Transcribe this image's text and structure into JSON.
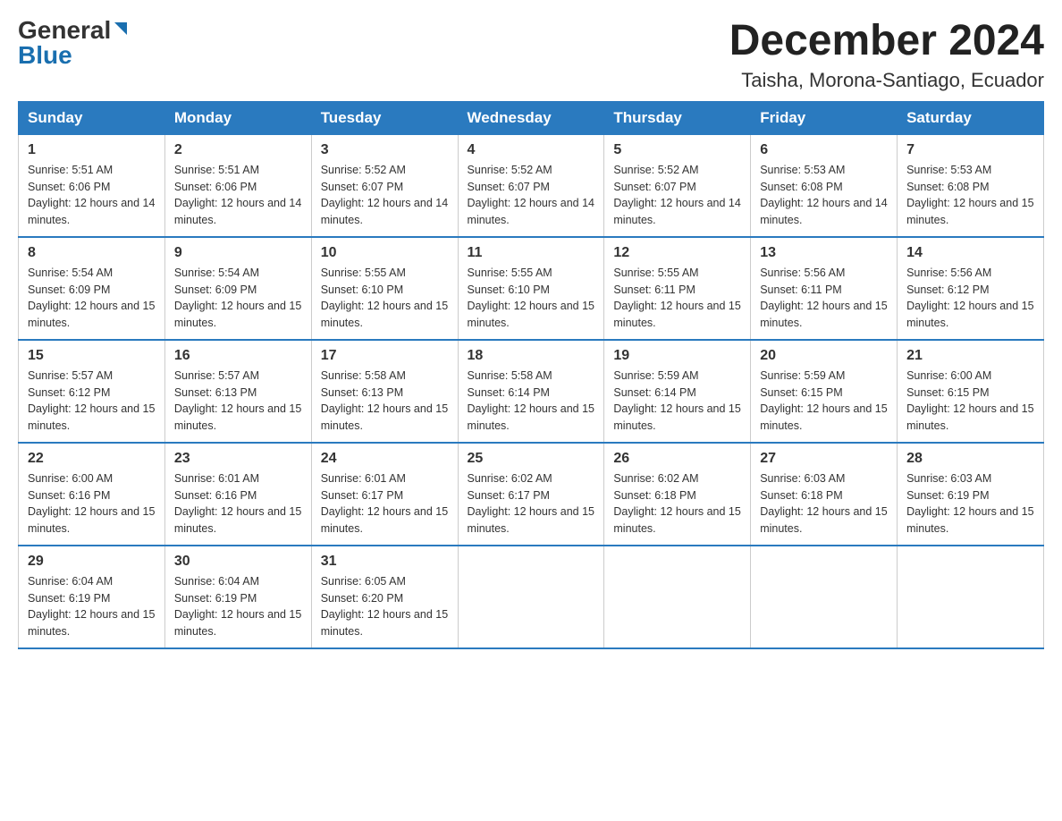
{
  "header": {
    "logo_general": "General",
    "logo_blue": "Blue",
    "month_title": "December 2024",
    "location": "Taisha, Morona-Santiago, Ecuador"
  },
  "days_of_week": [
    "Sunday",
    "Monday",
    "Tuesday",
    "Wednesday",
    "Thursday",
    "Friday",
    "Saturday"
  ],
  "weeks": [
    [
      {
        "day": "1",
        "sunrise": "5:51 AM",
        "sunset": "6:06 PM",
        "daylight": "12 hours and 14 minutes."
      },
      {
        "day": "2",
        "sunrise": "5:51 AM",
        "sunset": "6:06 PM",
        "daylight": "12 hours and 14 minutes."
      },
      {
        "day": "3",
        "sunrise": "5:52 AM",
        "sunset": "6:07 PM",
        "daylight": "12 hours and 14 minutes."
      },
      {
        "day": "4",
        "sunrise": "5:52 AM",
        "sunset": "6:07 PM",
        "daylight": "12 hours and 14 minutes."
      },
      {
        "day": "5",
        "sunrise": "5:52 AM",
        "sunset": "6:07 PM",
        "daylight": "12 hours and 14 minutes."
      },
      {
        "day": "6",
        "sunrise": "5:53 AM",
        "sunset": "6:08 PM",
        "daylight": "12 hours and 14 minutes."
      },
      {
        "day": "7",
        "sunrise": "5:53 AM",
        "sunset": "6:08 PM",
        "daylight": "12 hours and 15 minutes."
      }
    ],
    [
      {
        "day": "8",
        "sunrise": "5:54 AM",
        "sunset": "6:09 PM",
        "daylight": "12 hours and 15 minutes."
      },
      {
        "day": "9",
        "sunrise": "5:54 AM",
        "sunset": "6:09 PM",
        "daylight": "12 hours and 15 minutes."
      },
      {
        "day": "10",
        "sunrise": "5:55 AM",
        "sunset": "6:10 PM",
        "daylight": "12 hours and 15 minutes."
      },
      {
        "day": "11",
        "sunrise": "5:55 AM",
        "sunset": "6:10 PM",
        "daylight": "12 hours and 15 minutes."
      },
      {
        "day": "12",
        "sunrise": "5:55 AM",
        "sunset": "6:11 PM",
        "daylight": "12 hours and 15 minutes."
      },
      {
        "day": "13",
        "sunrise": "5:56 AM",
        "sunset": "6:11 PM",
        "daylight": "12 hours and 15 minutes."
      },
      {
        "day": "14",
        "sunrise": "5:56 AM",
        "sunset": "6:12 PM",
        "daylight": "12 hours and 15 minutes."
      }
    ],
    [
      {
        "day": "15",
        "sunrise": "5:57 AM",
        "sunset": "6:12 PM",
        "daylight": "12 hours and 15 minutes."
      },
      {
        "day": "16",
        "sunrise": "5:57 AM",
        "sunset": "6:13 PM",
        "daylight": "12 hours and 15 minutes."
      },
      {
        "day": "17",
        "sunrise": "5:58 AM",
        "sunset": "6:13 PM",
        "daylight": "12 hours and 15 minutes."
      },
      {
        "day": "18",
        "sunrise": "5:58 AM",
        "sunset": "6:14 PM",
        "daylight": "12 hours and 15 minutes."
      },
      {
        "day": "19",
        "sunrise": "5:59 AM",
        "sunset": "6:14 PM",
        "daylight": "12 hours and 15 minutes."
      },
      {
        "day": "20",
        "sunrise": "5:59 AM",
        "sunset": "6:15 PM",
        "daylight": "12 hours and 15 minutes."
      },
      {
        "day": "21",
        "sunrise": "6:00 AM",
        "sunset": "6:15 PM",
        "daylight": "12 hours and 15 minutes."
      }
    ],
    [
      {
        "day": "22",
        "sunrise": "6:00 AM",
        "sunset": "6:16 PM",
        "daylight": "12 hours and 15 minutes."
      },
      {
        "day": "23",
        "sunrise": "6:01 AM",
        "sunset": "6:16 PM",
        "daylight": "12 hours and 15 minutes."
      },
      {
        "day": "24",
        "sunrise": "6:01 AM",
        "sunset": "6:17 PM",
        "daylight": "12 hours and 15 minutes."
      },
      {
        "day": "25",
        "sunrise": "6:02 AM",
        "sunset": "6:17 PM",
        "daylight": "12 hours and 15 minutes."
      },
      {
        "day": "26",
        "sunrise": "6:02 AM",
        "sunset": "6:18 PM",
        "daylight": "12 hours and 15 minutes."
      },
      {
        "day": "27",
        "sunrise": "6:03 AM",
        "sunset": "6:18 PM",
        "daylight": "12 hours and 15 minutes."
      },
      {
        "day": "28",
        "sunrise": "6:03 AM",
        "sunset": "6:19 PM",
        "daylight": "12 hours and 15 minutes."
      }
    ],
    [
      {
        "day": "29",
        "sunrise": "6:04 AM",
        "sunset": "6:19 PM",
        "daylight": "12 hours and 15 minutes."
      },
      {
        "day": "30",
        "sunrise": "6:04 AM",
        "sunset": "6:19 PM",
        "daylight": "12 hours and 15 minutes."
      },
      {
        "day": "31",
        "sunrise": "6:05 AM",
        "sunset": "6:20 PM",
        "daylight": "12 hours and 15 minutes."
      },
      null,
      null,
      null,
      null
    ]
  ]
}
